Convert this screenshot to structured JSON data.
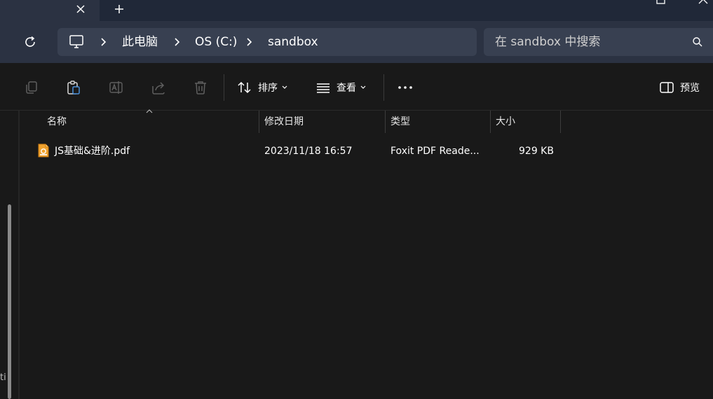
{
  "tabs": {
    "close_glyph": "✕",
    "new_tab_glyph": "+"
  },
  "address": {
    "crumbs": [
      "此电脑",
      "OS (C:)",
      "sandbox"
    ]
  },
  "search": {
    "placeholder": "在 sandbox 中搜索"
  },
  "toolbar": {
    "sort_label": "排序",
    "view_label": "查看",
    "more_glyph": "•••",
    "preview_label": "预览"
  },
  "columns": [
    "名称",
    "修改日期",
    "类型",
    "大小"
  ],
  "files": [
    {
      "name": "JS基础&进阶.pdf",
      "modified": "2023/11/18 16:57",
      "type": "Foxit PDF Reade...",
      "size": "929 KB"
    }
  ],
  "nav": {
    "edge_glyph": "ti"
  },
  "colors": {
    "tab_strip": "#202838",
    "address_bar": "#2b3242",
    "field_bg": "#384051",
    "content_bg": "#191919",
    "pdf_icon": "#f0a22e"
  }
}
